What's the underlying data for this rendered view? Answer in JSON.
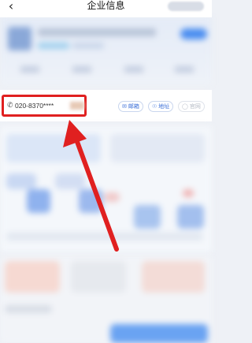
{
  "header": {
    "back_icon": "chevron-left-icon",
    "title": "企业信息"
  },
  "contact": {
    "phone_icon": "phone-icon",
    "phone_text": "020-8370****",
    "actions": [
      {
        "icon": "mail-icon",
        "label": "邮箱"
      },
      {
        "icon": "location-icon",
        "label": "地址"
      },
      {
        "icon": "globe-icon",
        "label": "官网"
      }
    ]
  },
  "colors": {
    "highlight": "#e02020",
    "accent": "#3b6fd8"
  }
}
